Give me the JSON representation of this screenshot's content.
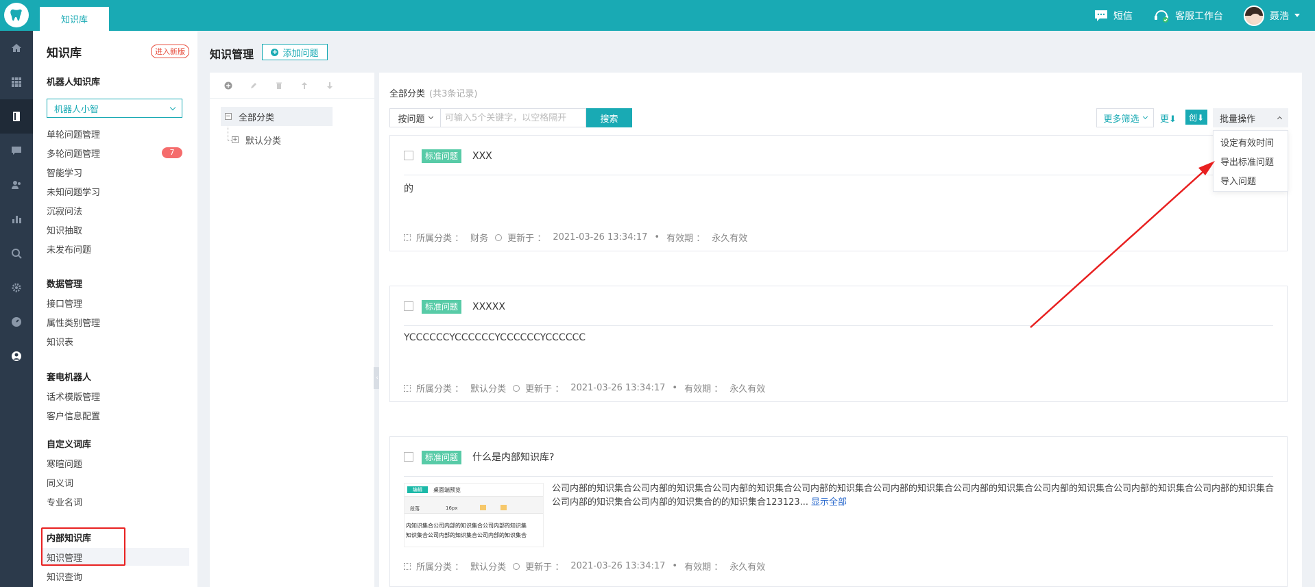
{
  "topbar": {
    "tab_label": "知识库",
    "sms_label": "短信",
    "workbench_label": "客服工作台",
    "user_name": "聂浩"
  },
  "sidebar": {
    "title": "知识库",
    "new_version_label": "进入新版",
    "robot_kb_section": "机器人知识库",
    "robot_select_value": "机器人小智",
    "robot_items": [
      "单轮问题管理",
      "多轮问题管理",
      "智能学习",
      "未知问题学习",
      "沉寂问法",
      "知识抽取",
      "未发布问题"
    ],
    "multi_badge": "7",
    "data_section": "数据管理",
    "data_items": [
      "接口管理",
      "属性类别管理",
      "知识表"
    ],
    "call_section": "套电机器人",
    "call_items": [
      "话术模版管理",
      "客户信息配置"
    ],
    "custom_section": "自定义词库",
    "custom_items": [
      "寒暄问题",
      "同义词",
      "专业名词"
    ],
    "internal_section": "内部知识库",
    "internal_items": [
      "知识管理",
      "知识查询"
    ]
  },
  "main": {
    "title": "知识管理",
    "add_button": "添加问题"
  },
  "tree": {
    "root": "全部分类",
    "child": "默认分类"
  },
  "content": {
    "crumb": "全部分类",
    "record_count": "(共3条记录)",
    "search_by": "按问题",
    "search_placeholder": "可输入5个关键字，以空格隔开",
    "search_button": "搜索",
    "more_filter": "更多筛选",
    "sort_update": "更⬇",
    "sort_create": "创⬇",
    "batch_label": "批量操作",
    "batch_menu": [
      "设定有效时间",
      "导出标准问题",
      "导入问题"
    ]
  },
  "cards": [
    {
      "tag": "标准问题",
      "question": "XXX",
      "answer": "的",
      "category_label": "所属分类",
      "category": "财务",
      "updated_label": "更新于",
      "updated": "2021-03-26 13:34:17",
      "valid_label": "有效期",
      "valid": "永久有效"
    },
    {
      "tag": "标准问题",
      "question": "XXXXX",
      "answer": "YCCCCCCYCCCCCCYCCCCCCYCCCCCC",
      "category_label": "所属分类",
      "category": "默认分类",
      "updated_label": "更新于",
      "updated": "2021-03-26 13:34:17",
      "valid_label": "有效期",
      "valid": "永久有效"
    },
    {
      "tag": "标准问题",
      "question": "什么是内部知识库?",
      "answer": "公司内部的知识集合公司内部的知识集合公司内部的知识集合公司内部的知识集合公司内部的知识集合公司内部的知识集合公司内部的知识集合公司内部的知识集合公司内部的知识集合公司内部的知识集合公司内部的知识集合的的知识集合123123...",
      "show_all": "显示全部",
      "thumb_tag": "编辑",
      "thumb_title": "桌面端预览",
      "thumb_font": "段落",
      "thumb_size": "16px",
      "thumb_line1": "内知识集合公司内部的知识集合公司内部的知识集",
      "thumb_line2": "知识集合公司内部的知识集合公司内部的知识集合",
      "category_label": "所属分类",
      "category": "默认分类",
      "updated_label": "更新于",
      "updated": "2021-03-26 13:34:17",
      "valid_label": "有效期",
      "valid": "永久有效"
    }
  ],
  "colors": {
    "brand": "#19aab4",
    "tag": "#58cba7",
    "badge": "#f56c6c",
    "annotation": "#e82020"
  }
}
